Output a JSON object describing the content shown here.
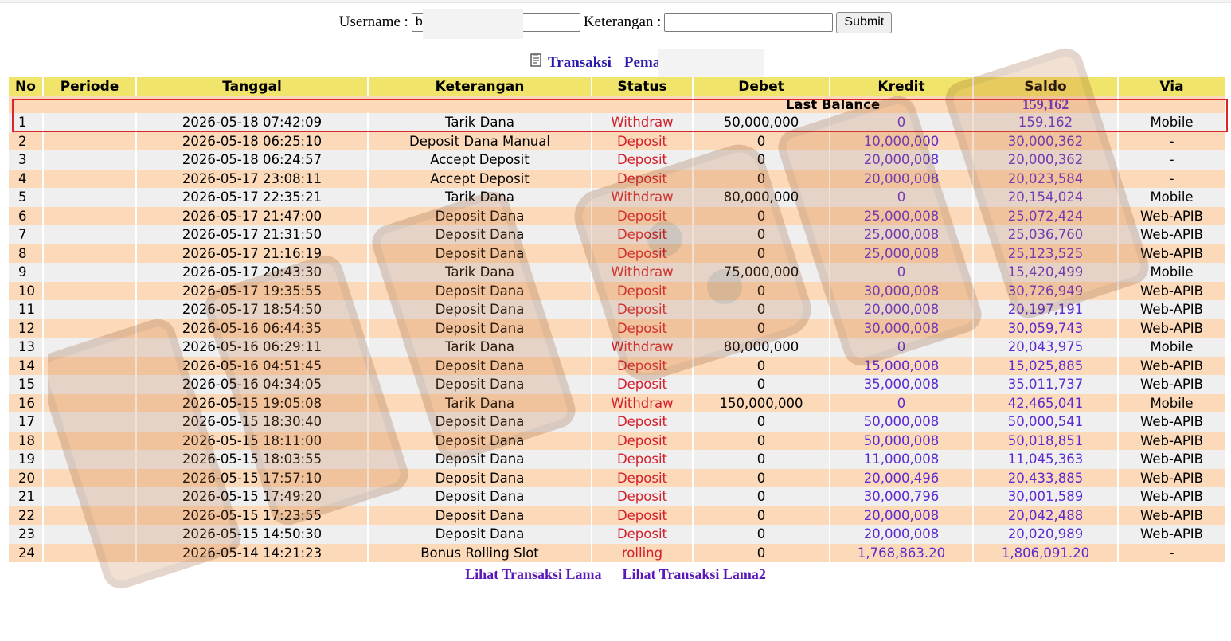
{
  "form": {
    "username_label": "Username :",
    "username_value": "b",
    "keterangan_label": "Keterangan :",
    "keterangan_value": "",
    "submit_label": "Submit"
  },
  "title": {
    "transaksi": "Transaksi",
    "pemain": "Pemain : be"
  },
  "table": {
    "headers": {
      "no": "No",
      "periode": "Periode",
      "tanggal": "Tanggal",
      "keterangan": "Keterangan",
      "status": "Status",
      "debet": "Debet",
      "kredit": "Kredit",
      "saldo": "Saldo",
      "via": "Via"
    },
    "last_balance_label": "Last Balance",
    "last_balance_value": "159,162",
    "rows": [
      {
        "no": "1",
        "periode": "",
        "tanggal": "2026-05-18 07:42:09",
        "keterangan": "Tarik Dana",
        "status": "Withdraw",
        "debet": "50,000,000",
        "kredit": "0",
        "saldo": "159,162",
        "via": "Mobile"
      },
      {
        "no": "2",
        "periode": "",
        "tanggal": "2026-05-18 06:25:10",
        "keterangan": "Deposit Dana Manual",
        "status": "Deposit",
        "debet": "0",
        "kredit": "10,000,000",
        "saldo": "30,000,362",
        "via": "-"
      },
      {
        "no": "3",
        "periode": "",
        "tanggal": "2026-05-18 06:24:57",
        "keterangan": "Accept Deposit",
        "status": "Deposit",
        "debet": "0",
        "kredit": "20,000,008",
        "saldo": "20,000,362",
        "via": "-"
      },
      {
        "no": "4",
        "periode": "",
        "tanggal": "2026-05-17 23:08:11",
        "keterangan": "Accept Deposit",
        "status": "Deposit",
        "debet": "0",
        "kredit": "20,000,008",
        "saldo": "20,023,584",
        "via": "-"
      },
      {
        "no": "5",
        "periode": "",
        "tanggal": "2026-05-17 22:35:21",
        "keterangan": "Tarik Dana",
        "status": "Withdraw",
        "debet": "80,000,000",
        "kredit": "0",
        "saldo": "20,154,024",
        "via": "Mobile"
      },
      {
        "no": "6",
        "periode": "",
        "tanggal": "2026-05-17 21:47:00",
        "keterangan": "Deposit Dana",
        "status": "Deposit",
        "debet": "0",
        "kredit": "25,000,008",
        "saldo": "25,072,424",
        "via": "Web-APIB"
      },
      {
        "no": "7",
        "periode": "",
        "tanggal": "2026-05-17 21:31:50",
        "keterangan": "Deposit Dana",
        "status": "Deposit",
        "debet": "0",
        "kredit": "25,000,008",
        "saldo": "25,036,760",
        "via": "Web-APIB"
      },
      {
        "no": "8",
        "periode": "",
        "tanggal": "2026-05-17 21:16:19",
        "keterangan": "Deposit Dana",
        "status": "Deposit",
        "debet": "0",
        "kredit": "25,000,008",
        "saldo": "25,123,525",
        "via": "Web-APIB"
      },
      {
        "no": "9",
        "periode": "",
        "tanggal": "2026-05-17 20:43:30",
        "keterangan": "Tarik Dana",
        "status": "Withdraw",
        "debet": "75,000,000",
        "kredit": "0",
        "saldo": "15,420,499",
        "via": "Mobile"
      },
      {
        "no": "10",
        "periode": "",
        "tanggal": "2026-05-17 19:35:55",
        "keterangan": "Deposit Dana",
        "status": "Deposit",
        "debet": "0",
        "kredit": "30,000,008",
        "saldo": "30,726,949",
        "via": "Web-APIB"
      },
      {
        "no": "11",
        "periode": "",
        "tanggal": "2026-05-17 18:54:50",
        "keterangan": "Deposit Dana",
        "status": "Deposit",
        "debet": "0",
        "kredit": "20,000,008",
        "saldo": "20,197,191",
        "via": "Web-APIB"
      },
      {
        "no": "12",
        "periode": "",
        "tanggal": "2026-05-16 06:44:35",
        "keterangan": "Deposit Dana",
        "status": "Deposit",
        "debet": "0",
        "kredit": "30,000,008",
        "saldo": "30,059,743",
        "via": "Web-APIB"
      },
      {
        "no": "13",
        "periode": "",
        "tanggal": "2026-05-16 06:29:11",
        "keterangan": "Tarik Dana",
        "status": "Withdraw",
        "debet": "80,000,000",
        "kredit": "0",
        "saldo": "20,043,975",
        "via": "Mobile"
      },
      {
        "no": "14",
        "periode": "",
        "tanggal": "2026-05-16 04:51:45",
        "keterangan": "Deposit Dana",
        "status": "Deposit",
        "debet": "0",
        "kredit": "15,000,008",
        "saldo": "15,025,885",
        "via": "Web-APIB"
      },
      {
        "no": "15",
        "periode": "",
        "tanggal": "2026-05-16 04:34:05",
        "keterangan": "Deposit Dana",
        "status": "Deposit",
        "debet": "0",
        "kredit": "35,000,008",
        "saldo": "35,011,737",
        "via": "Web-APIB"
      },
      {
        "no": "16",
        "periode": "",
        "tanggal": "2026-05-15 19:05:08",
        "keterangan": "Tarik Dana",
        "status": "Withdraw",
        "debet": "150,000,000",
        "kredit": "0",
        "saldo": "42,465,041",
        "via": "Mobile"
      },
      {
        "no": "17",
        "periode": "",
        "tanggal": "2026-05-15 18:30:40",
        "keterangan": "Deposit Dana",
        "status": "Deposit",
        "debet": "0",
        "kredit": "50,000,008",
        "saldo": "50,000,541",
        "via": "Web-APIB"
      },
      {
        "no": "18",
        "periode": "",
        "tanggal": "2026-05-15 18:11:00",
        "keterangan": "Deposit Dana",
        "status": "Deposit",
        "debet": "0",
        "kredit": "50,000,008",
        "saldo": "50,018,851",
        "via": "Web-APIB"
      },
      {
        "no": "19",
        "periode": "",
        "tanggal": "2026-05-15 18:03:55",
        "keterangan": "Deposit Dana",
        "status": "Deposit",
        "debet": "0",
        "kredit": "11,000,008",
        "saldo": "11,045,363",
        "via": "Web-APIB"
      },
      {
        "no": "20",
        "periode": "",
        "tanggal": "2026-05-15 17:57:10",
        "keterangan": "Deposit Dana",
        "status": "Deposit",
        "debet": "0",
        "kredit": "20,000,496",
        "saldo": "20,433,885",
        "via": "Web-APIB"
      },
      {
        "no": "21",
        "periode": "",
        "tanggal": "2026-05-15 17:49:20",
        "keterangan": "Deposit Dana",
        "status": "Deposit",
        "debet": "0",
        "kredit": "30,000,796",
        "saldo": "30,001,589",
        "via": "Web-APIB"
      },
      {
        "no": "22",
        "periode": "",
        "tanggal": "2026-05-15 17:23:55",
        "keterangan": "Deposit Dana",
        "status": "Deposit",
        "debet": "0",
        "kredit": "20,000,008",
        "saldo": "20,042,488",
        "via": "Web-APIB"
      },
      {
        "no": "23",
        "periode": "",
        "tanggal": "2026-05-15 14:50:30",
        "keterangan": "Deposit Dana",
        "status": "Deposit",
        "debet": "0",
        "kredit": "20,000,008",
        "saldo": "20,020,989",
        "via": "Web-APIB"
      },
      {
        "no": "24",
        "periode": "",
        "tanggal": "2026-05-14 14:21:23",
        "keterangan": "Bonus Rolling Slot",
        "status": "rolling",
        "debet": "0",
        "kredit": "1,768,863.20",
        "saldo": "1,806,091.20",
        "via": "-"
      }
    ]
  },
  "footer": {
    "link1": "Lihat Transaksi Lama",
    "link2": "Lihat Transaksi Lama2"
  }
}
